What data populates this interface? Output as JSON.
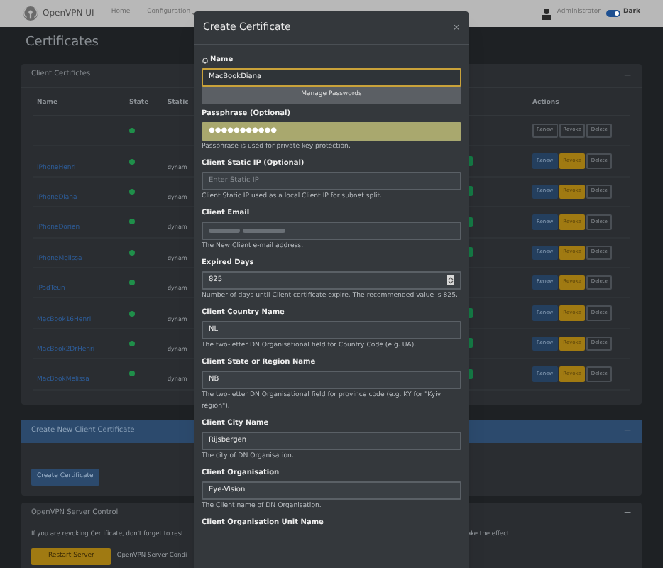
{
  "navbar": {
    "brand": "OpenVPN UI",
    "links": [
      {
        "label": "Home",
        "dropdown": false
      },
      {
        "label": "Configuration",
        "dropdown": true
      }
    ],
    "user": "Administrator",
    "theme_toggle": {
      "label": "Dark",
      "on": true
    }
  },
  "page_title": "Certificates",
  "client_certificates": {
    "title": "Client Certifictes",
    "collapse": "−",
    "columns": [
      "Name",
      "State",
      "Static",
      "Actions"
    ],
    "rows": [
      {
        "name": "",
        "static": "",
        "badge": false,
        "muted": true,
        "actions": [
          "Renew",
          "Revoke",
          "Delete"
        ]
      },
      {
        "name": "iPhoneHenri",
        "static": "dynam",
        "badge": true,
        "muted": false,
        "actions": [
          "Renew",
          "Revoke",
          "Delete"
        ]
      },
      {
        "name": "iPhoneDiana",
        "static": "dynam",
        "badge": true,
        "muted": false,
        "actions": [
          "Renew",
          "Revoke",
          "Delete"
        ]
      },
      {
        "name": "iPhoneDorien",
        "static": "dynam",
        "badge": true,
        "muted": false,
        "actions": [
          "Renew",
          "Revoke",
          "Delete"
        ]
      },
      {
        "name": "iPhoneMelissa",
        "static": "dynam",
        "badge": true,
        "muted": false,
        "actions": [
          "Renew",
          "Revoke",
          "Delete"
        ]
      },
      {
        "name": "iPadTeun",
        "static": "dynam",
        "badge": false,
        "muted": false,
        "actions": [
          "Renew",
          "Revoke",
          "Delete"
        ]
      },
      {
        "name": "MacBook16Henri",
        "static": "dynam",
        "badge": true,
        "muted": false,
        "actions": [
          "Renew",
          "Revoke",
          "Delete"
        ]
      },
      {
        "name": "MacBook2DrHenri",
        "static": "dynam",
        "badge": true,
        "muted": false,
        "actions": [
          "Renew",
          "Revoke",
          "Delete"
        ]
      },
      {
        "name": "MacBookMelissa",
        "static": "dynam",
        "badge": true,
        "muted": false,
        "actions": [
          "Renew",
          "Revoke",
          "Delete"
        ]
      }
    ]
  },
  "create_card": {
    "title": "Create New Client Certificate",
    "collapse": "−",
    "button": "Create Certificate"
  },
  "server_control": {
    "title": "OpenVPN Server Control",
    "collapse": "−",
    "note_left": "If you are revoking Certificate, don't forget to rest",
    "note_right": "ake the effect.",
    "button": "Restart Server",
    "status": "OpenVPN Server Condi"
  },
  "modal": {
    "title": "Create Certificate",
    "close": "×",
    "fields": [
      {
        "kind": "text",
        "label": "Name",
        "icon": true,
        "value": "MacBookDiana",
        "focused": true,
        "suggestion": "Manage Passwords"
      },
      {
        "kind": "password",
        "label": "Passphrase (Optional)",
        "value": "●●●●●●●●●●●",
        "autofilled": true,
        "help": "Passphrase is used for private key protection."
      },
      {
        "kind": "text",
        "label": "Client Static IP (Optional)",
        "placeholder": "Enter Static IP",
        "help": "Client Static IP used as a local Client IP for subnet split."
      },
      {
        "kind": "text",
        "label": "Client Email",
        "redacted": true,
        "help": "The New Client e-mail address."
      },
      {
        "kind": "number",
        "label": "Expired Days",
        "value": "825",
        "help": "Number of days until Client certificate expire. The recommended value is 825."
      },
      {
        "kind": "text",
        "label": "Client Country Name",
        "value": "NL",
        "help": "The two-letter DN Organisational field for Country Code (e.g. UA)."
      },
      {
        "kind": "text",
        "label": "Client State or Region Name",
        "value": "NB",
        "help": "The two-letter DN Organisational field for province code (e.g. KY for \"Kyiv region\")."
      },
      {
        "kind": "text",
        "label": "Client City Name",
        "value": "Rijsbergen",
        "help": "The city of DN Organisation."
      },
      {
        "kind": "text",
        "label": "Client Organisation",
        "value": "Eye-Vision",
        "help": "The Client name of DN Organisation."
      },
      {
        "kind": "label",
        "label": "Client Organisation Unit Name"
      }
    ]
  }
}
